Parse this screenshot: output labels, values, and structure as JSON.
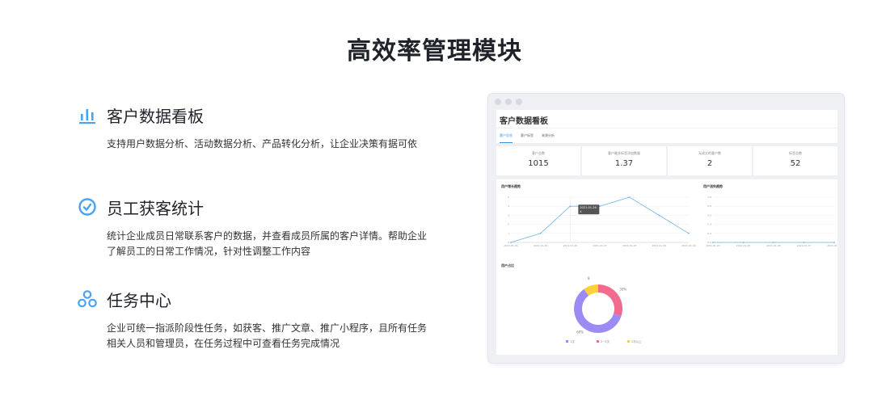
{
  "page": {
    "title": "高效率管理模块"
  },
  "features": [
    {
      "title": "客户数据看板",
      "icon": "bar-chart-icon",
      "desc": "支持用户数据分析、活动数据分析、产品转化分析，让企业决策有据可依"
    },
    {
      "title": "员工获客统计",
      "icon": "clock-check-icon",
      "desc": "统计企业成员日常联系客户的数据，并查看成员所属的客户详情。帮助企业了解员工的日常工作情况，针对性调整工作内容"
    },
    {
      "title": "任务中心",
      "icon": "cluster-icon",
      "desc": "企业可统一指派阶段性任务，如获客、推广文章、推广小程序，且所有任务相关人员和管理员，在任务过程中可查看任务完成情况"
    }
  ],
  "colors": {
    "accent": "#3a8ee6",
    "icon_blue": "#4aa3f0",
    "pie_purple": "#9b8cf5",
    "pie_pink": "#f06b8e",
    "pie_yellow": "#fdd135"
  },
  "mock": {
    "header": "客户数据看板",
    "tabs": [
      "客户总览",
      "客户标签",
      "来源分析"
    ],
    "stats": [
      {
        "label": "客户总数",
        "value": "1015"
      },
      {
        "label": "客户最多标签添加数量",
        "value": "1.37"
      },
      {
        "label": "无成交的客户数",
        "value": "2"
      },
      {
        "label": "标签总数",
        "value": "52"
      }
    ],
    "line_chart_title": "用户增长趋势",
    "line_chart2_title": "用户流失趋势",
    "pie_title": "用户占比"
  },
  "chart_data": [
    {
      "type": "line",
      "title": "用户增长趋势",
      "x": [
        "2021-01-24",
        "2021-01-25",
        "2021-01-26",
        "2021-01-27",
        "2021-01-28",
        "2021-01-29",
        "2021-01-30"
      ],
      "series": [
        {
          "values": [
            0,
            1,
            4,
            4,
            5,
            3,
            1
          ]
        }
      ],
      "ylim": [
        0,
        5
      ],
      "tooltip": {
        "date": "2021-01-26",
        "value": "4"
      }
    },
    {
      "type": "line",
      "title": "用户流失趋势",
      "x": [
        "2021-01-24",
        "2021-01-25",
        "2021-01-26",
        "2021-01-27",
        "2021-01-28"
      ],
      "series": [
        {
          "values": [
            0,
            0,
            0,
            0,
            0
          ]
        }
      ],
      "ylim": [
        0,
        1
      ]
    },
    {
      "type": "pie",
      "title": "用户占比",
      "slices": [
        {
          "name": "1次",
          "percent": "60%",
          "value": 60,
          "color": "#9b8cf5"
        },
        {
          "name": "2~5次",
          "percent": "30%",
          "value": 30,
          "color": "#f06b8e"
        },
        {
          "name": "5次以上",
          "percent": "8",
          "value": 10,
          "color": "#fdd135"
        }
      ]
    }
  ]
}
